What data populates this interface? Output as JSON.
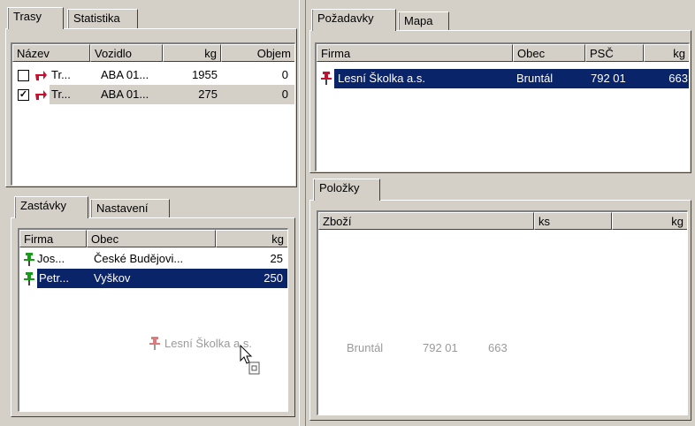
{
  "left_top": {
    "tabs": [
      "Trasy",
      "Statistika"
    ],
    "columns": [
      "Název",
      "Vozidlo",
      "kg",
      "Objem"
    ],
    "rows": [
      {
        "checked": "",
        "name": "Tr...",
        "vehicle": "ABA 01...",
        "kg": "1955",
        "volume": "0"
      },
      {
        "checked": "✓",
        "name": "Tr...",
        "vehicle": "ABA 01...",
        "kg": "275",
        "volume": "0"
      }
    ]
  },
  "left_bottom": {
    "tabs": [
      "Zastávky",
      "Nastavení"
    ],
    "columns": [
      "Firma",
      "Obec",
      "kg"
    ],
    "rows": [
      {
        "firm": "Jos...",
        "city": "České Budějovi...",
        "kg": "25"
      },
      {
        "firm": "Petr...",
        "city": "Vyškov",
        "kg": "250"
      }
    ],
    "drag_label": "Lesní Školka a.s."
  },
  "right_top": {
    "tabs": [
      "Požadavky",
      "Mapa"
    ],
    "columns": [
      "Firma",
      "Obec",
      "PSČ",
      "kg"
    ],
    "rows": [
      {
        "firm": "Lesní Školka a.s.",
        "city": "Bruntál",
        "zip": "792 01",
        "kg": "663"
      }
    ]
  },
  "right_bottom": {
    "tabs": [
      "Položky"
    ],
    "columns": [
      "Zboží",
      "ks",
      "kg"
    ],
    "ghost": {
      "city": "Bruntál",
      "zip": "792 01",
      "kg": "663"
    }
  },
  "colors": {
    "selection": "#0a246a",
    "pin_red": "#c8102e",
    "pin_green": "#1a9a1a"
  }
}
